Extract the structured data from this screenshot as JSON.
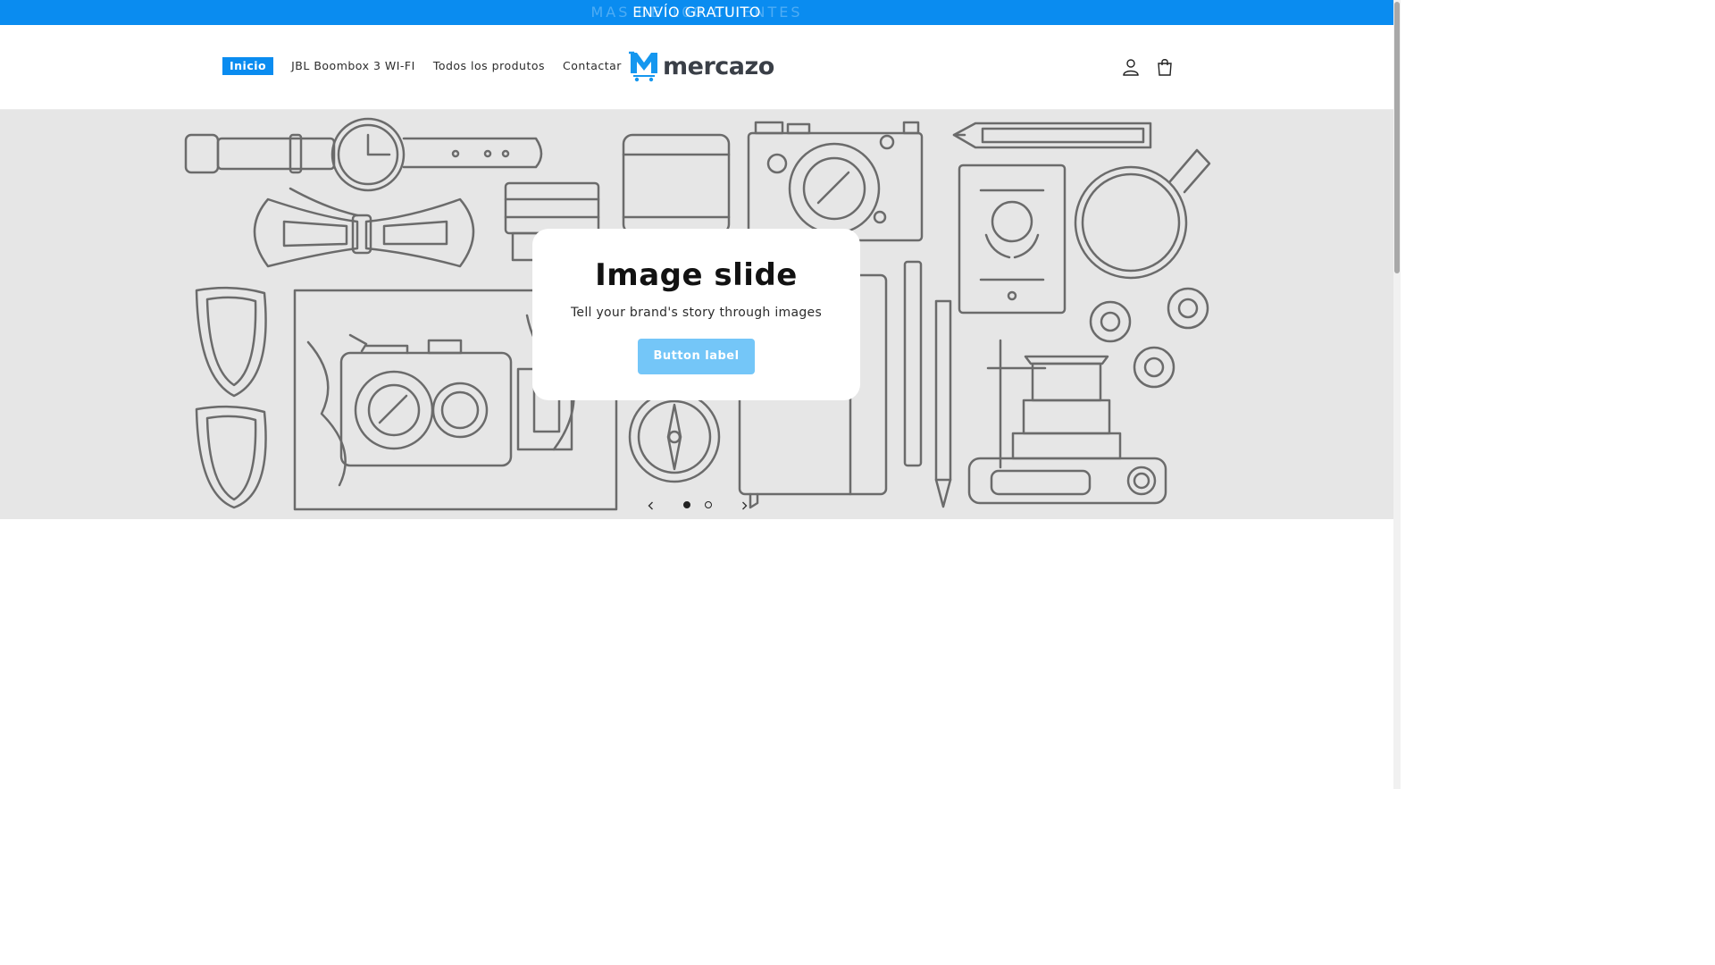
{
  "announcement": {
    "text": "ENVÍO GRATUITO",
    "ghost_text": "MAS DE 100 CLIENTES"
  },
  "nav": {
    "items": [
      {
        "label": "Inicio",
        "active": true
      },
      {
        "label": "JBL Boombox 3 WI-FI"
      },
      {
        "label": "Todos los produtos"
      },
      {
        "label": "Contactar"
      }
    ]
  },
  "logo": {
    "text": "mercazo",
    "mark": "M"
  },
  "header_icons": [
    "account-icon",
    "cart-icon"
  ],
  "hero": {
    "title": "Image slide",
    "subtitle": "Tell your brand's story through images",
    "button_label": "Button label",
    "slides_total": 2,
    "current_slide": 1
  },
  "colors": {
    "accent": "#0a8cf0",
    "button": "#74c6f8",
    "hero_bg": "#e6e6e6",
    "logo_text": "#3a3f47"
  }
}
